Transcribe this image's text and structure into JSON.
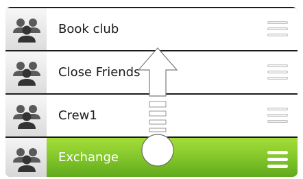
{
  "groups": [
    {
      "label": "Book club",
      "icon": "group-icon",
      "state": "normal"
    },
    {
      "label": "Close Friends",
      "icon": "group-icon",
      "state": "normal"
    },
    {
      "label": "Crew1",
      "icon": "group-icon",
      "state": "normal"
    },
    {
      "label": "Exchange",
      "icon": "group-icon",
      "state": "selected"
    }
  ],
  "gesture": {
    "direction": "up",
    "icon": "swipe-up-arrow-icon",
    "touch_point": "touch-point-icon"
  },
  "colors": {
    "selected_top": "#a4dd38",
    "selected_bottom": "#5ea91c",
    "list_bg": "#1c1c1c"
  }
}
